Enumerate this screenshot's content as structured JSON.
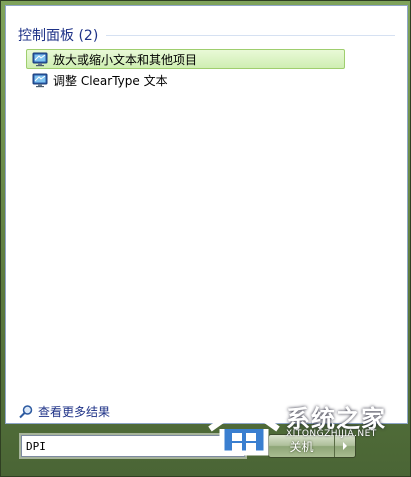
{
  "results_group": {
    "title": "控制面板 (2)",
    "items": [
      {
        "label": "放大或缩小文本和其他项目",
        "icon": "display-icon",
        "selected": true
      },
      {
        "label": "调整 ClearType 文本",
        "icon": "display-icon",
        "selected": false
      }
    ]
  },
  "see_more": {
    "label": "查看更多结果",
    "icon": "search-icon"
  },
  "search": {
    "value": "DPI",
    "clear_icon": "×"
  },
  "shutdown": {
    "label": "关机"
  },
  "watermark": {
    "name": "系统之家",
    "url": "XITONGZHIJIA.NET"
  },
  "colors": {
    "accent": "#1e3287",
    "selection": "#cfeeb2",
    "frame": "#6f8b52"
  }
}
